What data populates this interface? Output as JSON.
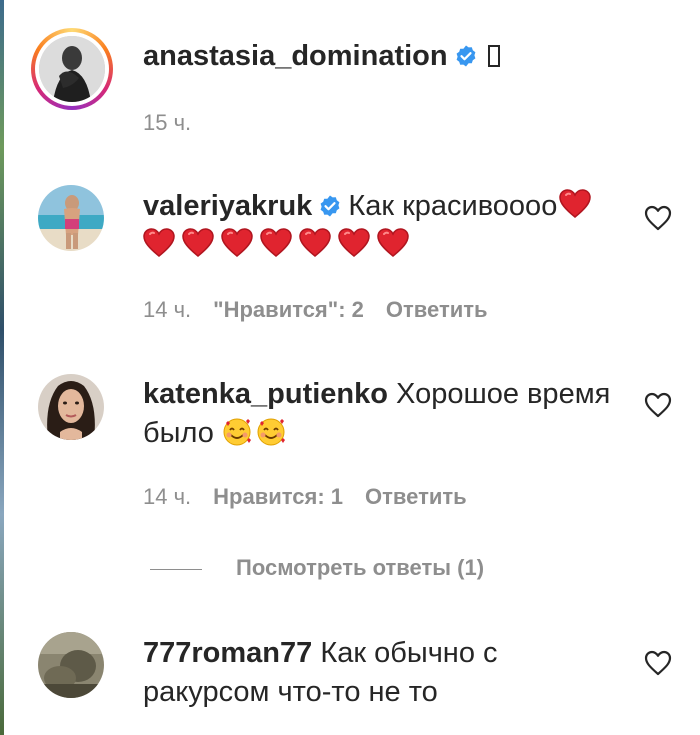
{
  "comments": [
    {
      "username": "anastasia_domination",
      "verified": true,
      "text": "",
      "tofu_glyph": true,
      "time": "15 ч.",
      "avatar_ring": true
    },
    {
      "username": "valeriyakruk",
      "verified": true,
      "text": "Как красивоооо",
      "time": "14 ч.",
      "likes": "\"Нравится\": 2",
      "reply": "Ответить",
      "heart_emoji_count": 8
    },
    {
      "username": "katenka_putienko",
      "verified": false,
      "text_line1": "Хорошое время",
      "text_line2": "было",
      "time": "14 ч.",
      "likes": "Нравится: 1",
      "reply": "Ответить",
      "face_emoji_count": 2
    },
    {
      "username": "777roman77",
      "verified": false,
      "text_line1": "Как обычно с",
      "text_line2": "ракурсом что-то не то"
    }
  ],
  "view_replies": "Посмотреть ответы (1)",
  "icons": {
    "verified": "verified-badge-icon",
    "like": "heart-outline-icon",
    "heart_emoji": "red-heart-emoji",
    "face_emoji": "smiling-face-with-hearts-emoji"
  },
  "colors": {
    "text": "#262626",
    "muted": "#8e8e8e",
    "verified": "#3897f0",
    "heart": "#e0242f"
  }
}
